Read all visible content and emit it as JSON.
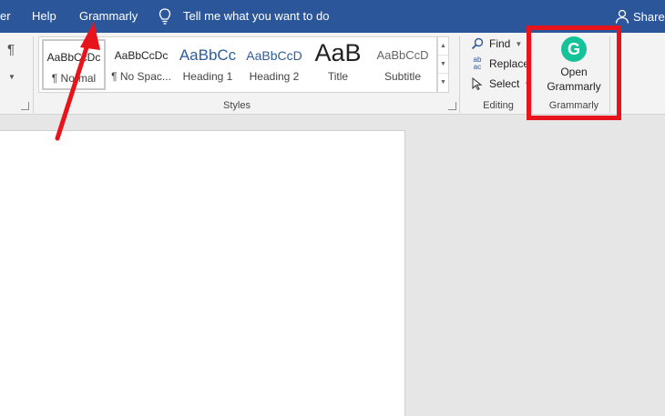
{
  "menubar": {
    "items": [
      "er",
      "Help",
      "Grammarly"
    ],
    "tell_me": "Tell me what you want to do",
    "share": "Share"
  },
  "ribbon": {
    "paragraph_glyph": "¶",
    "styles": {
      "label": "Styles",
      "tiles": [
        {
          "preview": "AaBbCcDc",
          "name": "¶ Normal"
        },
        {
          "preview": "AaBbCcDc",
          "name": "¶ No Spac..."
        },
        {
          "preview": "AaBbCc",
          "name": "Heading 1"
        },
        {
          "preview": "AaBbCcD",
          "name": "Heading 2"
        },
        {
          "preview": "AaB",
          "name": "Title"
        },
        {
          "preview": "AaBbCcD",
          "name": "Subtitle"
        }
      ]
    },
    "editing": {
      "label": "Editing",
      "find": "Find",
      "replace": "Replace",
      "select": "Select",
      "replace_icon_top": "ab",
      "replace_icon_bottom": "ac"
    },
    "grammarly": {
      "label": "Grammarly",
      "button_line1": "Open",
      "button_line2": "Grammarly",
      "logo_letter": "G"
    }
  },
  "colors": {
    "menubar": "#2b579a",
    "ribbon": "#f3f3f3",
    "grammarly_green": "#15c39a",
    "annotation_red": "#e8141c"
  },
  "icons": [
    "lightbulb-icon",
    "person-icon",
    "magnifier-icon",
    "replace-icon",
    "cursor-icon",
    "grammarly-logo-icon",
    "dialog-launcher-icon"
  ]
}
